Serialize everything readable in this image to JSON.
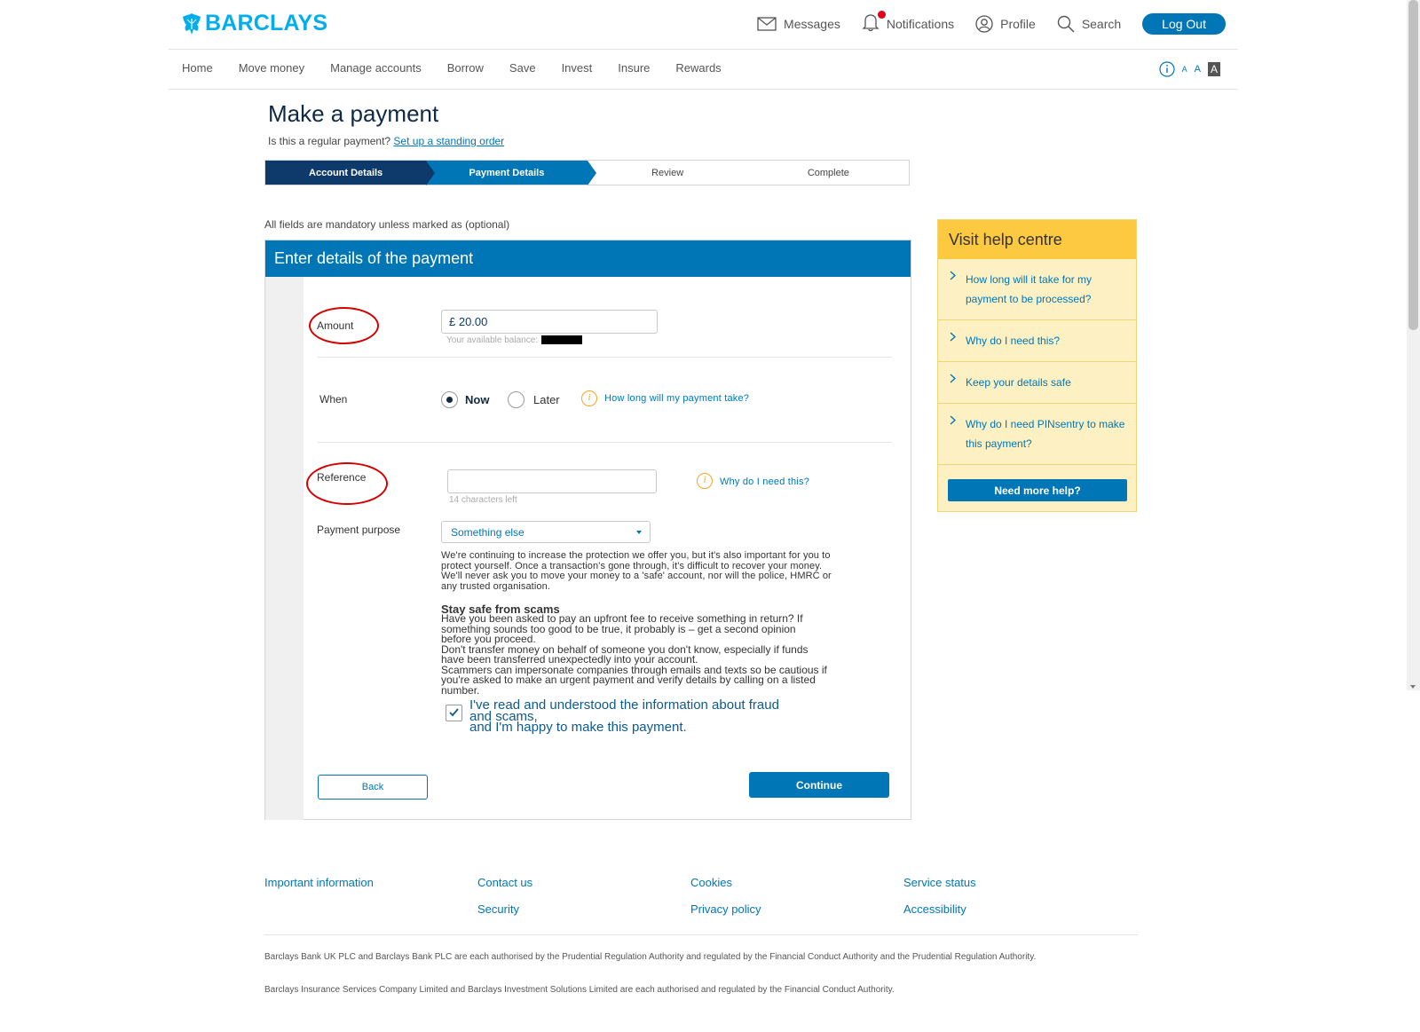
{
  "brand": {
    "name": "BARCLAYS",
    "color": "#00aeef"
  },
  "utility_nav": {
    "messages": "Messages",
    "notifications": "Notifications",
    "profile": "Profile",
    "search": "Search",
    "logout": "Log Out"
  },
  "main_nav": [
    "Home",
    "Move money",
    "Manage accounts",
    "Borrow",
    "Save",
    "Invest",
    "Insure",
    "Rewards"
  ],
  "text_size": [
    "A",
    "A",
    "A"
  ],
  "page": {
    "title": "Make a payment",
    "regular_question": "Is this a regular payment?",
    "standing_order_link": "Set up a standing order"
  },
  "steps": [
    {
      "label": "Account Details",
      "state": "done"
    },
    {
      "label": "Payment Details",
      "state": "active"
    },
    {
      "label": "Review",
      "state": "upcoming"
    },
    {
      "label": "Complete",
      "state": "upcoming"
    }
  ],
  "mandatory_note": "All fields are mandatory unless marked as (optional)",
  "form": {
    "heading": "Enter details of the payment",
    "amount": {
      "label": "Amount",
      "value": "£ 20.00",
      "balance_hint": "Your available balance:"
    },
    "when": {
      "label": "When",
      "option_now": "Now",
      "option_later": "Later",
      "selected": "Now",
      "help_link": "How long will my payment take?"
    },
    "reference": {
      "label": "Reference",
      "value": "",
      "hint": "14 characters left",
      "help_link": "Why do I need this?"
    },
    "purpose": {
      "label": "Payment purpose",
      "selected": "Something else",
      "protection_text": [
        "We're continuing to increase the protection we offer you, but it's also important for you to",
        "protect yourself. Once a transaction's gone through, it's difficult to recover your money.",
        "We'll never ask you to move your money to a 'safe' account, nor will the police, HMRC or",
        "any trusted organisation."
      ],
      "scam_title": "Stay safe from scams",
      "scam_text": [
        "Have you been asked to pay an upfront fee to receive something in return? If",
        "something sounds too good to be true, it probably is – get a second opinion",
        "before you proceed.",
        "Don't transfer money on behalf of someone you don't know, especially if funds",
        "have been transferred unexpectedly into your account.",
        "Scammers can impersonate companies through emails and texts so be cautious if",
        "you're asked to make an urgent payment and verify details by calling on a listed",
        "number."
      ],
      "confirm_checked": true,
      "confirm_text": [
        "I've read and understood the information about fraud",
        "and scams,",
        "and I'm happy to make this payment."
      ]
    },
    "back_label": "Back",
    "continue_label": "Continue"
  },
  "help_centre": {
    "title": "Visit help centre",
    "items": [
      "How long will it take for my payment to be processed?",
      "Why do I need this?",
      "Keep your details safe",
      "Why do I need PINsentry to make this payment?"
    ],
    "more_help": "Need more help?"
  },
  "footer": {
    "links": [
      "Important information",
      "Contact us",
      "Security",
      "Cookies",
      "Privacy policy",
      "Service status",
      "Accessibility"
    ],
    "legal": [
      "Barclays Bank UK PLC and Barclays Bank PLC are each authorised by the Prudential Regulation Authority and regulated by the Financial Conduct Authority and the Prudential Regulation Authority.",
      "Barclays Insurance Services Company Limited and Barclays Investment Solutions Limited are each authorised and regulated by the Financial Conduct Authority."
    ]
  },
  "colors": {
    "accent": "#0076b6",
    "navy": "#0d3a6a",
    "help_yellow": "#fcc940",
    "annotation_red": "#d40000"
  }
}
